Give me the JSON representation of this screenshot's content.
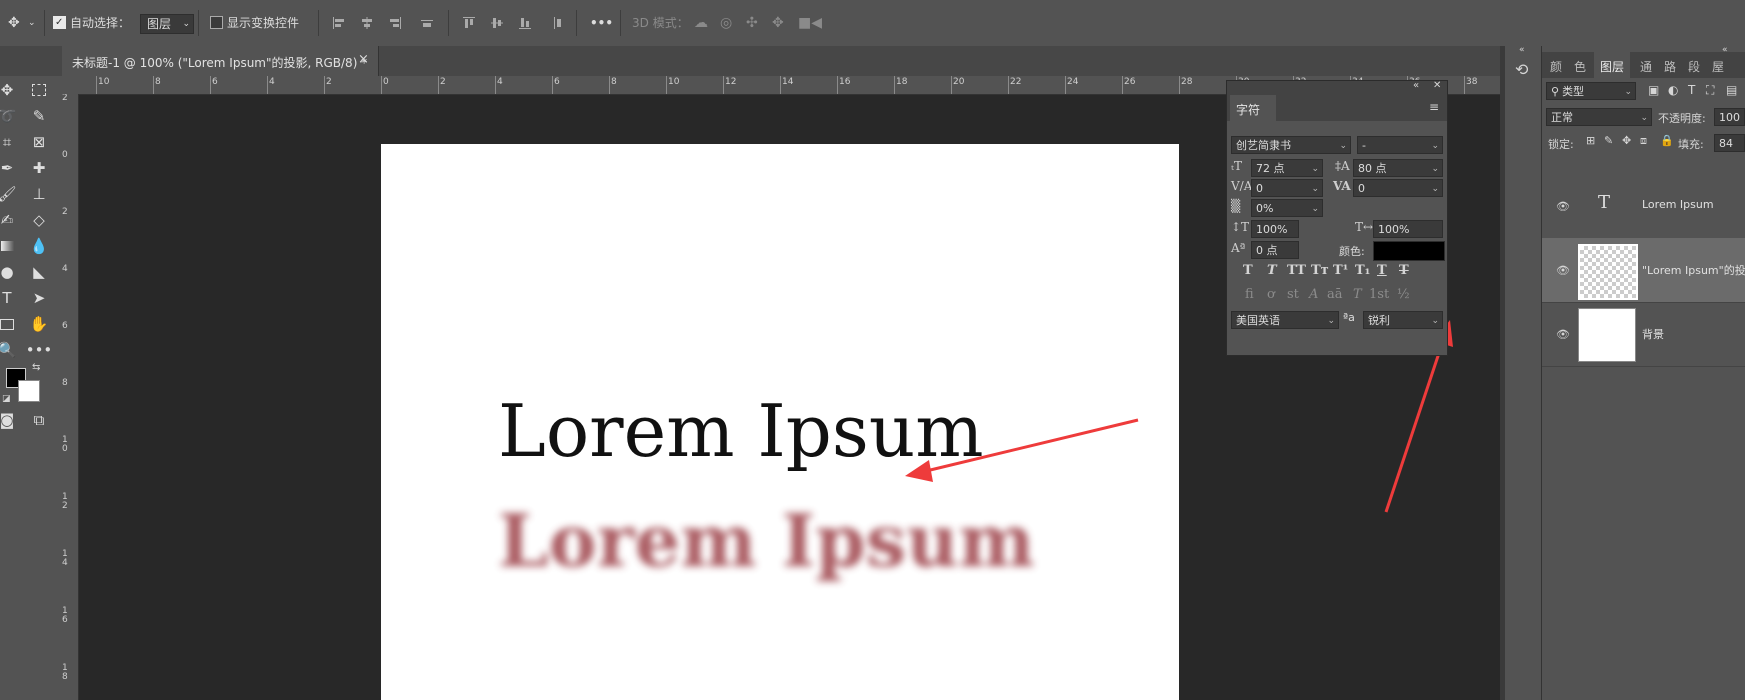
{
  "options_bar": {
    "auto_select_label": "自动选择：",
    "auto_select_checked": true,
    "auto_select_target": "图层",
    "show_transform_label": "显示变换控件",
    "show_transform_checked": false,
    "mode_3d_label": "3D 模式：",
    "more_label": "•••"
  },
  "document_tab": {
    "title": "未标题-1 @ 100% (\"Lorem Ipsum\"的投影, RGB/8) *",
    "close": "×"
  },
  "rulers": {
    "h_ticks": [
      "10",
      "8",
      "6",
      "4",
      "2",
      "0",
      "2",
      "4",
      "6",
      "8",
      "10",
      "12",
      "14",
      "16",
      "18",
      "20",
      "22",
      "24",
      "26",
      "28",
      "30",
      "32",
      "34",
      "36",
      "38"
    ],
    "v_ticks": [
      "2",
      "0",
      "2",
      "4",
      "6",
      "8",
      "1 0",
      "1 2",
      "1 4",
      "1 6",
      "1 8"
    ]
  },
  "canvas": {
    "main_text": "Lorem Ipsum",
    "shadow_text": "Lorem Ipsum"
  },
  "character_panel": {
    "tab_label": "字符",
    "font_family": "创艺简隶书",
    "font_style": "-",
    "font_size": "72 点",
    "leading": "80 点",
    "kerning": "0",
    "tracking": "0",
    "tsume": "0%",
    "vertical_scale": "100%",
    "horizontal_scale": "100%",
    "baseline_shift": "0 点",
    "color_label": "颜色:",
    "color_value": "#000000",
    "type_buttons": [
      "T",
      "T",
      "TT",
      "Tт",
      "T¹",
      "T₁",
      "T",
      "T"
    ],
    "opentype_buttons": [
      "fi",
      "ơ",
      "st",
      "A",
      "aā",
      "T",
      "1st",
      "½"
    ],
    "language": "美国英语",
    "aa_icon": "ªa",
    "antialias": "锐利"
  },
  "dock": {
    "collapse": "«",
    "history_icon": "history-icon"
  },
  "layers_panel": {
    "tabs": [
      "颜",
      "色",
      "图层",
      "通",
      "路",
      "段",
      "屋"
    ],
    "active_tab": "图层",
    "filter_label": "类型",
    "blend_mode": "正常",
    "opacity_label": "不透明度:",
    "opacity_value": "100",
    "lock_label": "锁定:",
    "fill_label": "填充:",
    "fill_value": "84",
    "layers": [
      {
        "name": "Lorem Ipsum",
        "type": "text"
      },
      {
        "name": "\"Lorem Ipsum\"的投影",
        "type": "pixel"
      },
      {
        "name": "背景",
        "type": "background"
      }
    ]
  },
  "colors": {
    "app_bg": "#535353",
    "canvas_bg": "#282828",
    "shadow_text": "#a24b52",
    "arrow": "#ee3b3b"
  }
}
